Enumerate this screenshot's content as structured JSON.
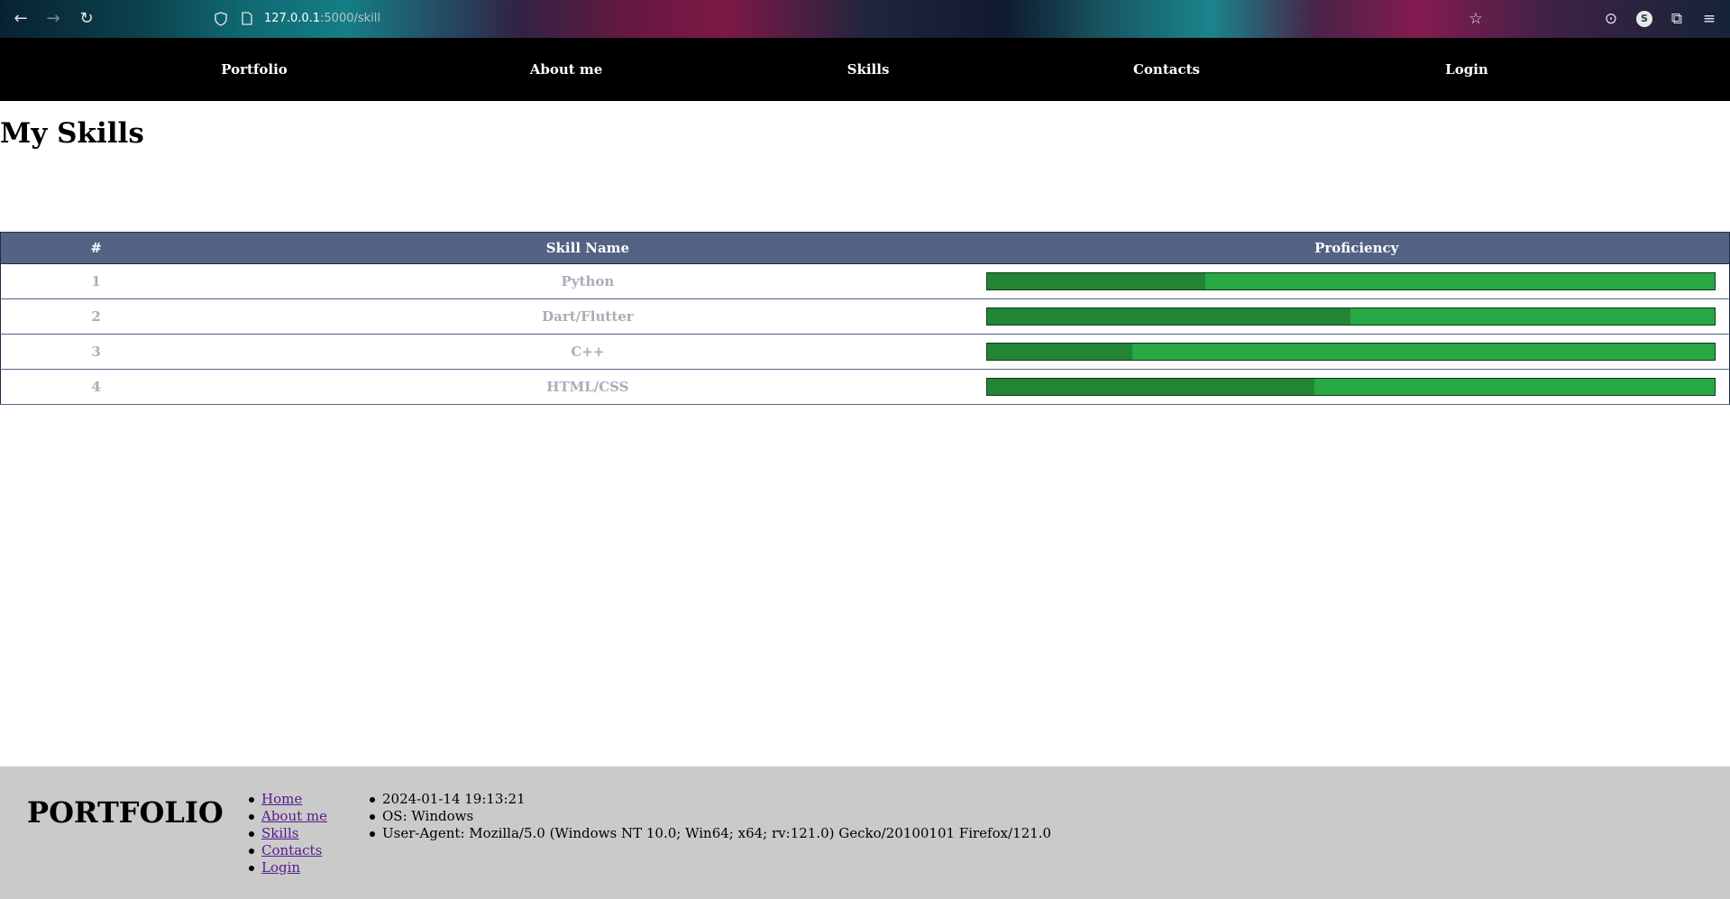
{
  "browser": {
    "back": "←",
    "forward": "→",
    "reload": "↻",
    "url_host": "127.0.0.1",
    "url_rest": ":5000/skill",
    "bookmark": "☆",
    "pocket": "⊙",
    "profile_letter": "S",
    "extensions": "⧉",
    "menu": "≡"
  },
  "nav": {
    "items": [
      "Portfolio",
      "About me",
      "Skills",
      "Contacts",
      "Login"
    ]
  },
  "page": {
    "title": "My Skills"
  },
  "table": {
    "headers": [
      "#",
      "Skill Name",
      "Proficiency"
    ],
    "rows": [
      {
        "num": "1",
        "name": "Python",
        "proficiency": 0.3
      },
      {
        "num": "2",
        "name": "Dart/Flutter",
        "proficiency": 0.5
      },
      {
        "num": "3",
        "name": "C++",
        "proficiency": 0.2
      },
      {
        "num": "4",
        "name": "HTML/CSS",
        "proficiency": 0.45
      }
    ],
    "bar_color": "#28a745",
    "fill_color": "#218535"
  },
  "footer": {
    "logo": "PORTFOLIO",
    "links": [
      "Home",
      "About me",
      "Skills",
      "Contacts",
      "Login"
    ],
    "info": [
      "2024-01-14 19:13:21",
      "OS: Windows",
      "User-Agent: Mozilla/5.0 (Windows NT 10.0; Win64; x64; rv:121.0) Gecko/20100101 Firefox/121.0"
    ]
  }
}
